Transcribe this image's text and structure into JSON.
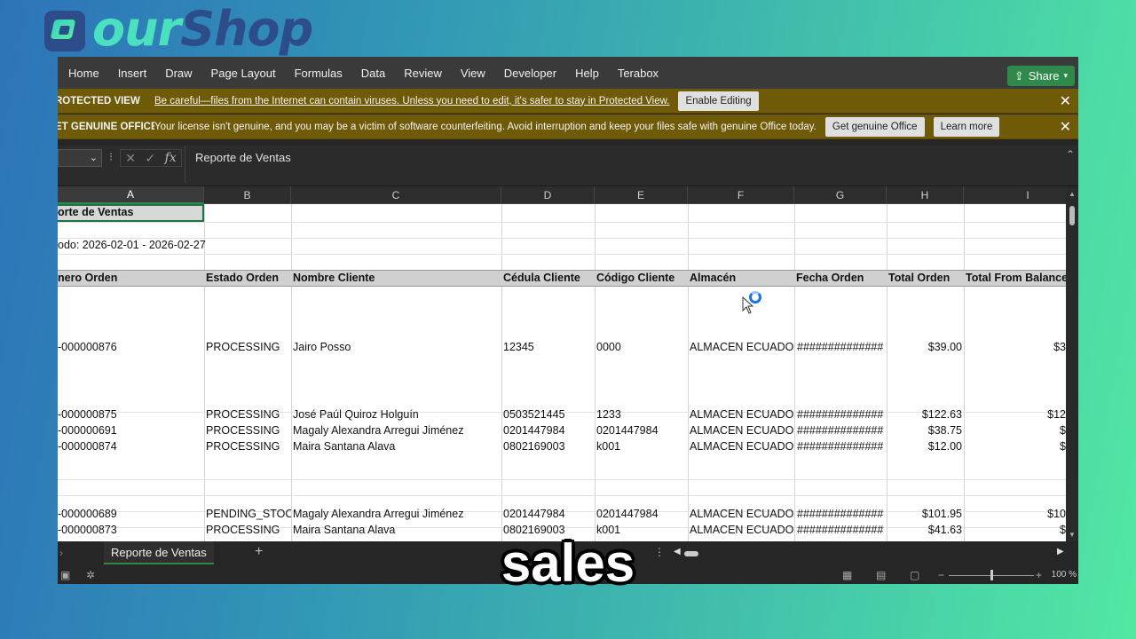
{
  "brand": {
    "part1": "our",
    "part2": "Sh",
    "part3": "op"
  },
  "ribbon": {
    "tabs": [
      "Home",
      "Insert",
      "Draw",
      "Page Layout",
      "Formulas",
      "Data",
      "Review",
      "View",
      "Developer",
      "Help",
      "Terabox"
    ],
    "share_label": "Share"
  },
  "protected_view": {
    "title": "ROTECTED VIEW",
    "message": "Be careful—files from the Internet can contain viruses. Unless you need to edit, it's safer to stay in Protected View.",
    "button": "Enable Editing"
  },
  "genuine_office": {
    "title": "ET GENUINE OFFICE",
    "message": "Your license isn't genuine, and you may be a victim of software counterfeiting. Avoid interruption and keep your files safe with genuine Office today.",
    "button1": "Get genuine Office",
    "button2": "Learn more"
  },
  "formula_bar": {
    "fx": "fx",
    "content": "Reporte de Ventas"
  },
  "columns": [
    "A",
    "B",
    "C",
    "D",
    "E",
    "F",
    "G",
    "H",
    "I"
  ],
  "sheet": {
    "title": "orte de Ventas",
    "period": "odo: 2026-02-01 - 2026-02-27",
    "headers": [
      "nero Orden",
      "Estado Orden",
      "Nombre Cliente",
      "Cédula Cliente",
      "Código Cliente",
      "Almacén",
      "Fecha Orden",
      "Total Orden",
      "Total From Balance"
    ],
    "rows": [
      [
        "-000000876",
        "PROCESSING",
        "Jairo Posso",
        "12345",
        "0000",
        "ALMACEN ECUADOR",
        "##############",
        "$39.00",
        "$3"
      ],
      [
        "-000000875",
        "PROCESSING",
        "José Paúl   Quiroz Holguín",
        "0503521445",
        "1233",
        "ALMACEN ECUADOR",
        "##############",
        "$122.63",
        "$12"
      ],
      [
        "-000000691",
        "PROCESSING",
        "Magaly Alexandra Arregui Jiménez",
        "0201447984",
        "0201447984",
        "ALMACEN ECUADOR",
        "##############",
        "$38.75",
        "$"
      ],
      [
        "-000000874",
        "PROCESSING",
        "Maira  Santana Alava",
        "0802169003",
        "k001",
        "ALMACEN ECUADOR",
        "##############",
        "$12.00",
        "$"
      ],
      [
        "-000000689",
        "PENDING_STOCK",
        "Magaly Alexandra Arregui Jiménez",
        "0201447984",
        "0201447984",
        "ALMACEN ECUADOR",
        "##############",
        "$101.95",
        "$10"
      ],
      [
        "-000000873",
        "PROCESSING",
        "Maira  Santana Alava",
        "0802169003",
        "k001",
        "ALMACEN ECUADOR",
        "##############",
        "$41.63",
        "$"
      ]
    ]
  },
  "sheet_tab": "Reporte de Ventas",
  "zoom": "100 %",
  "caption": "sales"
}
